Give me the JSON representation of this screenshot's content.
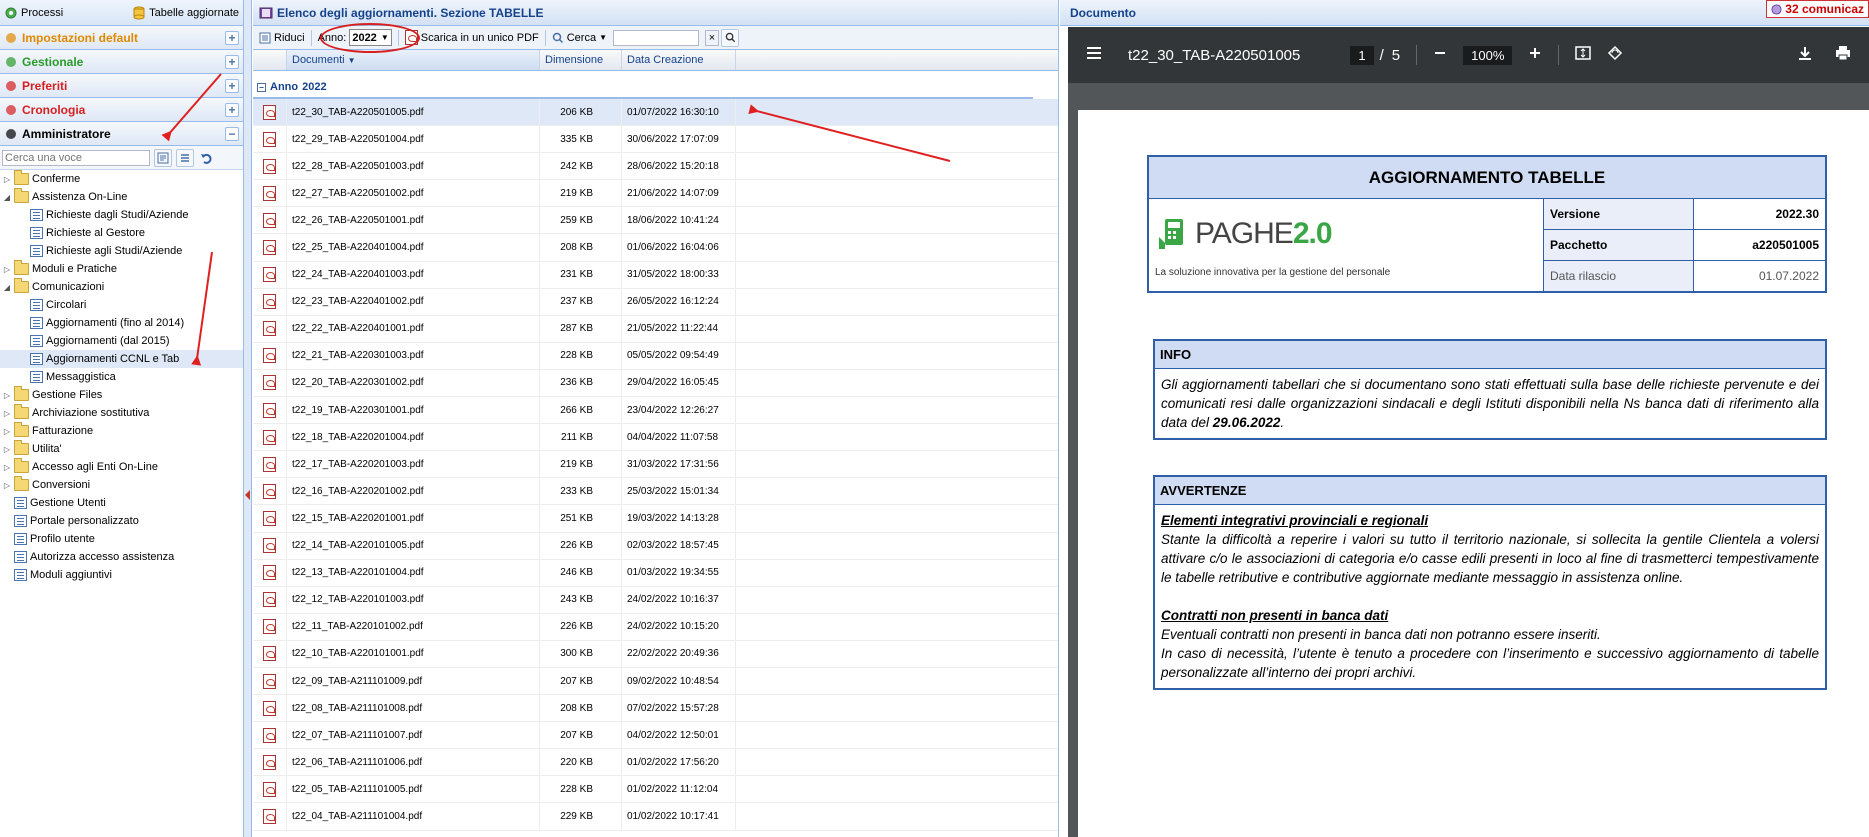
{
  "left": {
    "topbar": {
      "processi": "Processi",
      "tabelle": "Tabelle aggiornate"
    },
    "accordion": [
      {
        "label": "Impostazioni default",
        "color": "#e08a00",
        "btn": "+"
      },
      {
        "label": "Gestionale",
        "color": "#2a9b2a",
        "btn": "+"
      },
      {
        "label": "Preferiti",
        "color": "#d62020",
        "btn": "+"
      },
      {
        "label": "Cronologia",
        "color": "#d62020",
        "btn": "+"
      },
      {
        "label": "Amministratore",
        "color": "#000000",
        "btn": "−"
      }
    ],
    "search_placeholder": "Cerca una voce",
    "tree": [
      {
        "label": "Conferme",
        "type": "folder",
        "level": 0,
        "tw": "▷"
      },
      {
        "label": "Assistenza On-Line",
        "type": "folder",
        "level": 0,
        "tw": "◢"
      },
      {
        "label": "Richieste dagli Studi/Aziende",
        "type": "leaf",
        "level": 1
      },
      {
        "label": "Richieste al Gestore",
        "type": "leaf",
        "level": 1
      },
      {
        "label": "Richieste agli Studi/Aziende",
        "type": "leaf",
        "level": 1
      },
      {
        "label": "Moduli e Pratiche",
        "type": "folder",
        "level": 0,
        "tw": "▷"
      },
      {
        "label": "Comunicazioni",
        "type": "folder",
        "level": 0,
        "tw": "◢"
      },
      {
        "label": "Circolari",
        "type": "leaf",
        "level": 1
      },
      {
        "label": "Aggiornamenti (fino al 2014)",
        "type": "leaf",
        "level": 1
      },
      {
        "label": "Aggiornamenti (dal 2015)",
        "type": "leaf",
        "level": 1
      },
      {
        "label": "Aggiornamenti CCNL e Tab",
        "type": "leaf",
        "level": 1,
        "selected": true
      },
      {
        "label": "Messaggistica",
        "type": "leaf",
        "level": 1
      },
      {
        "label": "Gestione Files",
        "type": "folder",
        "level": 0,
        "tw": "▷"
      },
      {
        "label": "Archiviazione sostitutiva",
        "type": "folder",
        "level": 0,
        "tw": "▷"
      },
      {
        "label": "Fatturazione",
        "type": "folder",
        "level": 0,
        "tw": "▷"
      },
      {
        "label": "Utilita'",
        "type": "folder",
        "level": 0,
        "tw": "▷"
      },
      {
        "label": "Accesso agli Enti On-Line",
        "type": "folder",
        "level": 0,
        "tw": "▷"
      },
      {
        "label": "Conversioni",
        "type": "folder",
        "level": 0,
        "tw": "▷"
      },
      {
        "label": "Gestione Utenti",
        "type": "leaf",
        "level": 0
      },
      {
        "label": "Portale personalizzato",
        "type": "leaf",
        "level": 0
      },
      {
        "label": "Profilo utente",
        "type": "leaf",
        "level": 0
      },
      {
        "label": "Autorizza accesso assistenza",
        "type": "leaf",
        "level": 0
      },
      {
        "label": "Moduli aggiuntivi",
        "type": "leaf",
        "level": 0
      }
    ]
  },
  "mid": {
    "title": "Elenco degli aggiornamenti. Sezione TABELLE",
    "toolbar": {
      "riduci": "Riduci",
      "anno_label": "Anno:",
      "anno_value": "2022",
      "scarica": "Scarica in un unico PDF",
      "cerca": "Cerca",
      "clear": "×"
    },
    "columns": [
      "Documenti",
      "Dimensione",
      "Data Creazione"
    ],
    "group": {
      "label": "Anno",
      "value": "2022",
      "toggle": "−"
    },
    "rows": [
      [
        "t22_30_TAB-A220501005.pdf",
        "206 KB",
        "01/07/2022 16:30:10"
      ],
      [
        "t22_29_TAB-A220501004.pdf",
        "335 KB",
        "30/06/2022 17:07:09"
      ],
      [
        "t22_28_TAB-A220501003.pdf",
        "242 KB",
        "28/06/2022 15:20:18"
      ],
      [
        "t22_27_TAB-A220501002.pdf",
        "219 KB",
        "21/06/2022 14:07:09"
      ],
      [
        "t22_26_TAB-A220501001.pdf",
        "259 KB",
        "18/06/2022 10:41:24"
      ],
      [
        "t22_25_TAB-A220401004.pdf",
        "208 KB",
        "01/06/2022 16:04:06"
      ],
      [
        "t22_24_TAB-A220401003.pdf",
        "231 KB",
        "31/05/2022 18:00:33"
      ],
      [
        "t22_23_TAB-A220401002.pdf",
        "237 KB",
        "26/05/2022 16:12:24"
      ],
      [
        "t22_22_TAB-A220401001.pdf",
        "287 KB",
        "21/05/2022 11:22:44"
      ],
      [
        "t22_21_TAB-A220301003.pdf",
        "228 KB",
        "05/05/2022 09:54:49"
      ],
      [
        "t22_20_TAB-A220301002.pdf",
        "236 KB",
        "29/04/2022 16:05:45"
      ],
      [
        "t22_19_TAB-A220301001.pdf",
        "266 KB",
        "23/04/2022 12:26:27"
      ],
      [
        "t22_18_TAB-A220201004.pdf",
        "211 KB",
        "04/04/2022 11:07:58"
      ],
      [
        "t22_17_TAB-A220201003.pdf",
        "219 KB",
        "31/03/2022 17:31:56"
      ],
      [
        "t22_16_TAB-A220201002.pdf",
        "233 KB",
        "25/03/2022 15:01:34"
      ],
      [
        "t22_15_TAB-A220201001.pdf",
        "251 KB",
        "19/03/2022 14:13:28"
      ],
      [
        "t22_14_TAB-A220101005.pdf",
        "226 KB",
        "02/03/2022 18:57:45"
      ],
      [
        "t22_13_TAB-A220101004.pdf",
        "246 KB",
        "01/03/2022 19:34:55"
      ],
      [
        "t22_12_TAB-A220101003.pdf",
        "243 KB",
        "24/02/2022 10:16:37"
      ],
      [
        "t22_11_TAB-A220101002.pdf",
        "226 KB",
        "24/02/2022 10:15:20"
      ],
      [
        "t22_10_TAB-A220101001.pdf",
        "300 KB",
        "22/02/2022 20:49:36"
      ],
      [
        "t22_09_TAB-A211101009.pdf",
        "207 KB",
        "09/02/2022 10:48:54"
      ],
      [
        "t22_08_TAB-A211101008.pdf",
        "208 KB",
        "07/02/2022 15:57:28"
      ],
      [
        "t22_07_TAB-A211101007.pdf",
        "207 KB",
        "04/02/2022 12:50:01"
      ],
      [
        "t22_06_TAB-A211101006.pdf",
        "220 KB",
        "01/02/2022 17:56:20"
      ],
      [
        "t22_05_TAB-A211101005.pdf",
        "228 KB",
        "01/02/2022 11:12:04"
      ],
      [
        "t22_04_TAB-A211101004.pdf",
        "229 KB",
        "01/02/2022 10:17:41"
      ]
    ]
  },
  "right": {
    "title": "Documento",
    "notification": "32 comunicaz",
    "viewer": {
      "filename": "t22_30_TAB-A220501005",
      "page": "1",
      "page_sep": "/",
      "pages": "5",
      "zoom": "100%"
    },
    "doc": {
      "header": "AGGIORNAMENTO TABELLE",
      "logo_text": "PAGHE",
      "logo_version": "2.0",
      "tagline": "La soluzione innovativa per la gestione del personale",
      "meta": [
        {
          "k": "Versione",
          "v": "2022.30"
        },
        {
          "k": "Pacchetto",
          "v": "a220501005"
        },
        {
          "k": "Data rilascio",
          "v": "01.07.2022"
        }
      ],
      "info_title": "INFO",
      "info_text": "Gli aggiornamenti tabellari che si documentano sono stati effettuati sulla base delle richieste pervenute e dei comunicati resi dalle organizzazioni sindacali e degli Istituti disponibili nella Ns banca dati di riferimento alla data del ",
      "info_date": "29.06.2022",
      "info_end": ".",
      "avv_title": "AVVERTENZE",
      "avv_sub1": "Elementi integrativi provinciali e regionali",
      "avv_text1": "Stante la difficoltà a reperire i valori su tutto il territorio nazionale, si sollecita la gentile Clientela a volersi attivare c/o le associazioni di categoria e/o casse edili presenti in loco al fine di trasmetterci tempestivamente le tabelle retributive e contributive aggiornate mediante messaggio in assistenza online.",
      "avv_sub2": "Contratti non presenti in banca dati",
      "avv_text2a": "Eventuali contratti non presenti in banca dati non potranno essere inseriti.",
      "avv_text2b": "In caso di necessità, l’utente è tenuto a procedere con l’inserimento e successivo aggiornamento di tabelle personalizzate all’interno dei propri archivi."
    }
  }
}
